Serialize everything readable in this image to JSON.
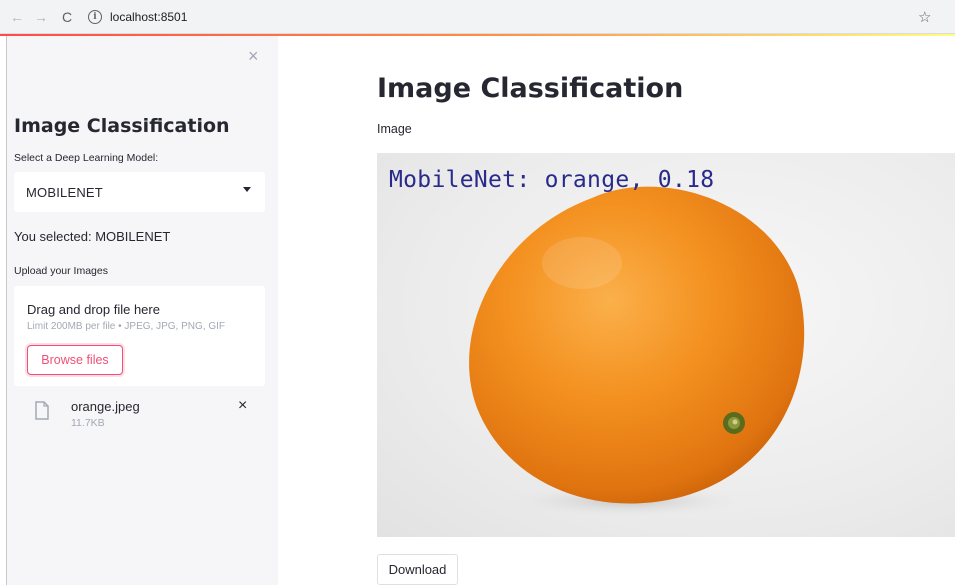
{
  "browser": {
    "url": "localhost:8501",
    "info_glyph": "i",
    "back_glyph": "←",
    "forward_glyph": "→",
    "reload_glyph": "C",
    "star_glyph": "☆"
  },
  "sidebar": {
    "close_glyph": "×",
    "title": "Image Classification",
    "select_label": "Select a Deep Learning Model:",
    "select_value": "MOBILENET",
    "selected_text": "You selected: MOBILENET",
    "upload_label": "Upload your Images",
    "dropzone": {
      "title": "Drag and drop file here",
      "limit": "Limit 200MB per file • JPEG, JPG, PNG, GIF",
      "browse_label": "Browse files"
    },
    "file": {
      "name": "orange.jpeg",
      "size": "11.7KB",
      "remove_glyph": "×"
    }
  },
  "main": {
    "title": "Image Classification",
    "image_label": "Image",
    "overlay_text": "MobileNet: orange, 0.18",
    "download_label": "Download"
  },
  "icons": {
    "back": "arrow-left-icon",
    "forward": "arrow-right-icon",
    "reload": "reload-icon",
    "info": "info-icon",
    "star": "star-icon",
    "close": "close-icon",
    "caret": "chevron-down-icon",
    "file": "file-icon"
  },
  "colors": {
    "accent": "#f14e78",
    "sidebar_bg": "#f6f6f8",
    "text": "#262730",
    "muted": "#a3a8b4",
    "overlay_text": "#2a2a8c",
    "orange": "#f28a1c"
  }
}
